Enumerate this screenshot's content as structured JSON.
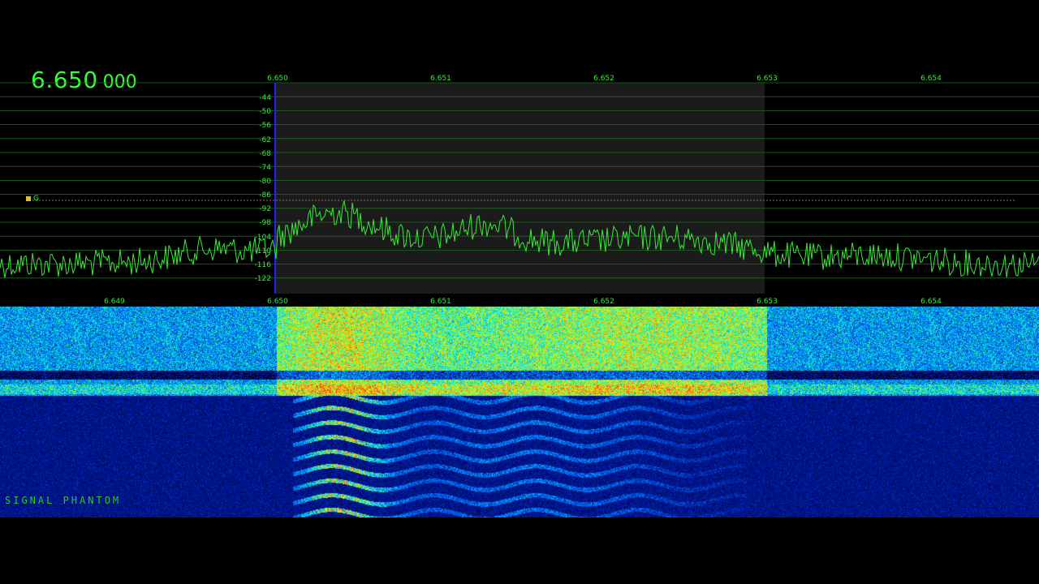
{
  "frequency_readout": {
    "main": "6.650",
    "sub": "000"
  },
  "top_frequency_ticks": [
    "6.650",
    "6.651",
    "6.652",
    "6.653",
    "6.654"
  ],
  "bottom_frequency_ticks": [
    "6.649",
    "6.650",
    "6.651",
    "6.652",
    "6.653",
    "6.654"
  ],
  "db_scale_labels": [
    "-44",
    "-50",
    "-56",
    "-62",
    "-68",
    "-74",
    "-80",
    "-86",
    "-92",
    "-98",
    "-104",
    "-110",
    "-116",
    "-122"
  ],
  "squelch_marker_label": "G",
  "watermark": "SIGNAL PHANTOM",
  "colors": {
    "trace": "#33ff33",
    "grid": "#1d6b1d",
    "passband": "#1a1a1a",
    "tuning_line": "#2222ff"
  }
}
